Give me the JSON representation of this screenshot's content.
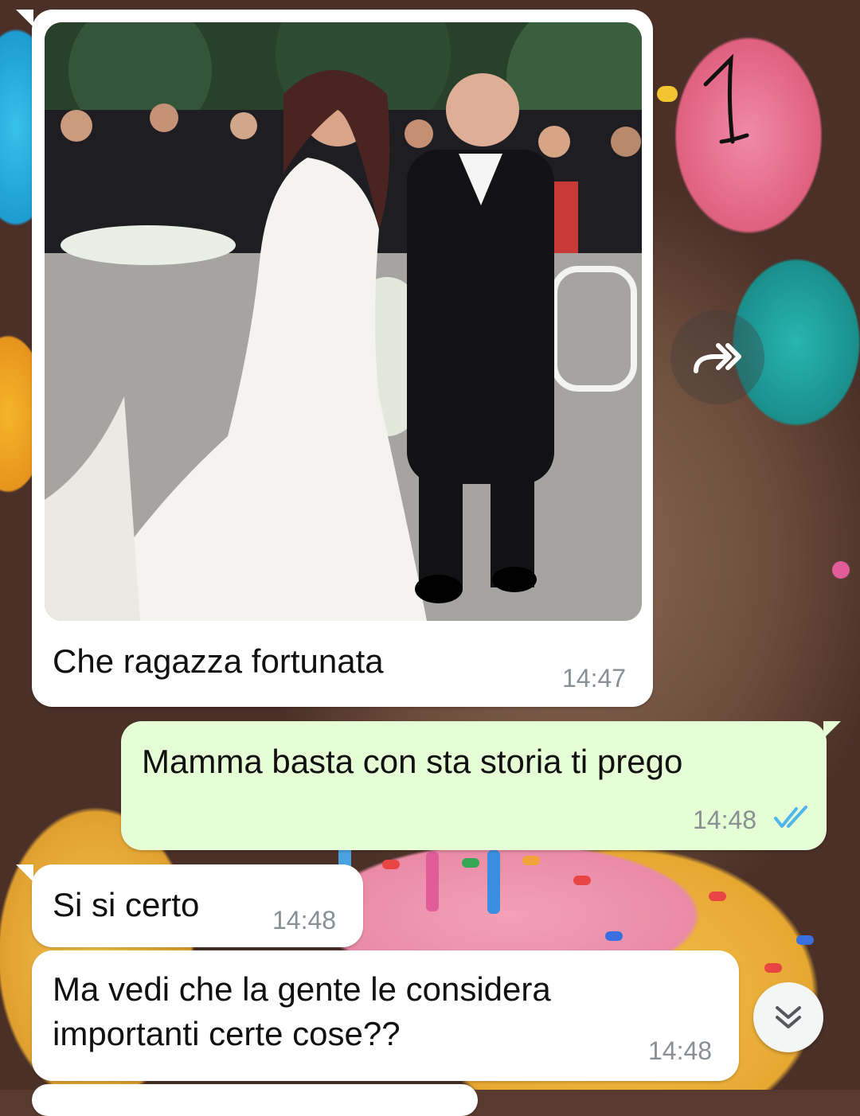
{
  "chat": {
    "messages": [
      {
        "direction": "incoming",
        "type": "image",
        "caption": "Che ragazza fortunata",
        "time": "14:47"
      },
      {
        "direction": "outgoing",
        "type": "text",
        "text": "Mamma basta con sta storia ti prego",
        "time": "14:48",
        "status": "read"
      },
      {
        "direction": "incoming",
        "type": "text",
        "text": "Si si certo",
        "time": "14:48"
      },
      {
        "direction": "incoming",
        "type": "text",
        "lines": [
          "Ma vedi che la gente le considera",
          "importanti certe cose??"
        ],
        "time": "14:48"
      }
    ]
  },
  "wallpaper": {
    "handwriting": "1"
  },
  "controls": {
    "forward_icon": "forward-arrow-icon",
    "scroll_down_icon": "double-chevron-down-icon"
  },
  "colors": {
    "incoming_bubble": "#ffffff",
    "outgoing_bubble": "#e6fed6",
    "read_ticks": "#4fb6ec",
    "timestamp": "#8a8f93"
  }
}
